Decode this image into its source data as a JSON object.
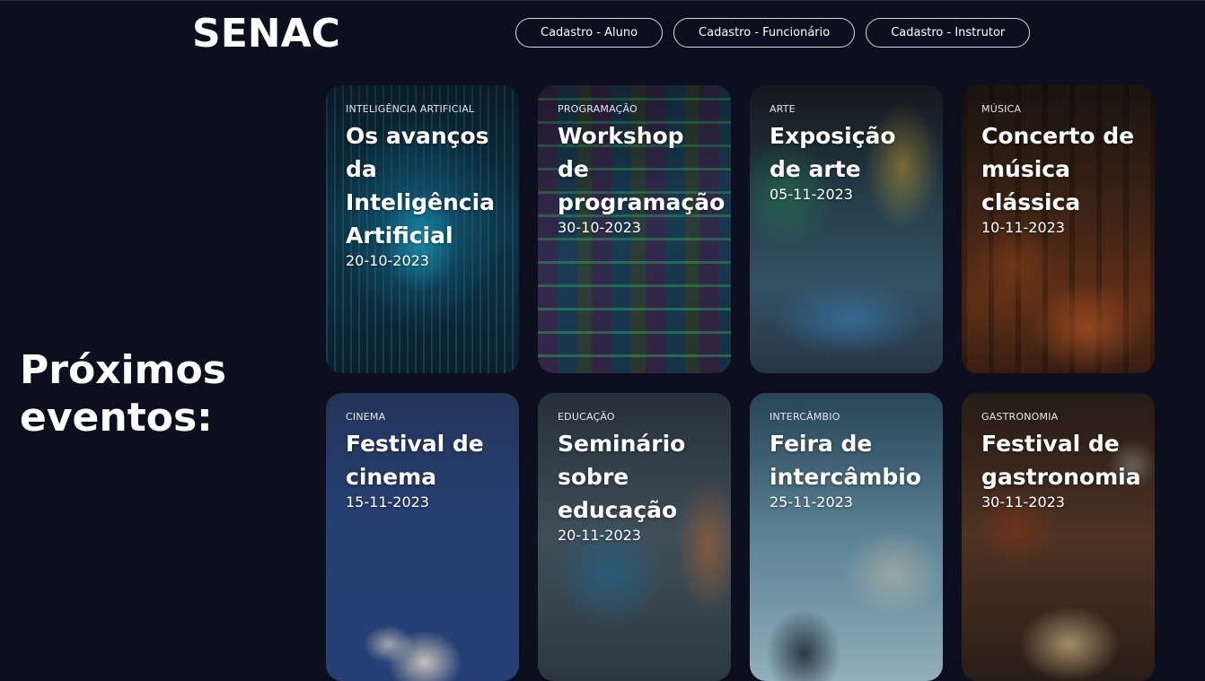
{
  "header": {
    "logo": "SENAC",
    "nav": [
      {
        "label": "Cadastro - Aluno"
      },
      {
        "label": "Cadastro - Funcionário"
      },
      {
        "label": "Cadastro - Instrutor"
      }
    ]
  },
  "main": {
    "heading": "Próximos eventos:",
    "events": [
      {
        "category": "INTELIGÊNCIA ARTIFICIAL",
        "title": "Os avanços da Inteligência Artificial",
        "date": "20-10-2023"
      },
      {
        "category": "PROGRAMAÇÃO",
        "title": "Workshop de programação",
        "date": "30-10-2023"
      },
      {
        "category": "ARTE",
        "title": "Exposição de arte",
        "date": "05-11-2023"
      },
      {
        "category": "MÚSICA",
        "title": "Concerto de música clássica",
        "date": "10-11-2023"
      },
      {
        "category": "CINEMA",
        "title": "Festival de cinema",
        "date": "15-11-2023"
      },
      {
        "category": "EDUCAÇÃO",
        "title": "Seminário sobre educação",
        "date": "20-11-2023"
      },
      {
        "category": "INTERCÂMBIO",
        "title": "Feira de intercâmbio",
        "date": "25-11-2023"
      },
      {
        "category": "GASTRONOMIA",
        "title": "Festival de gastronomia",
        "date": "30-11-2023"
      }
    ]
  },
  "colors": {
    "background": "#0e0f1e",
    "text": "#ffffff",
    "button_border": "#d8d8e0"
  }
}
